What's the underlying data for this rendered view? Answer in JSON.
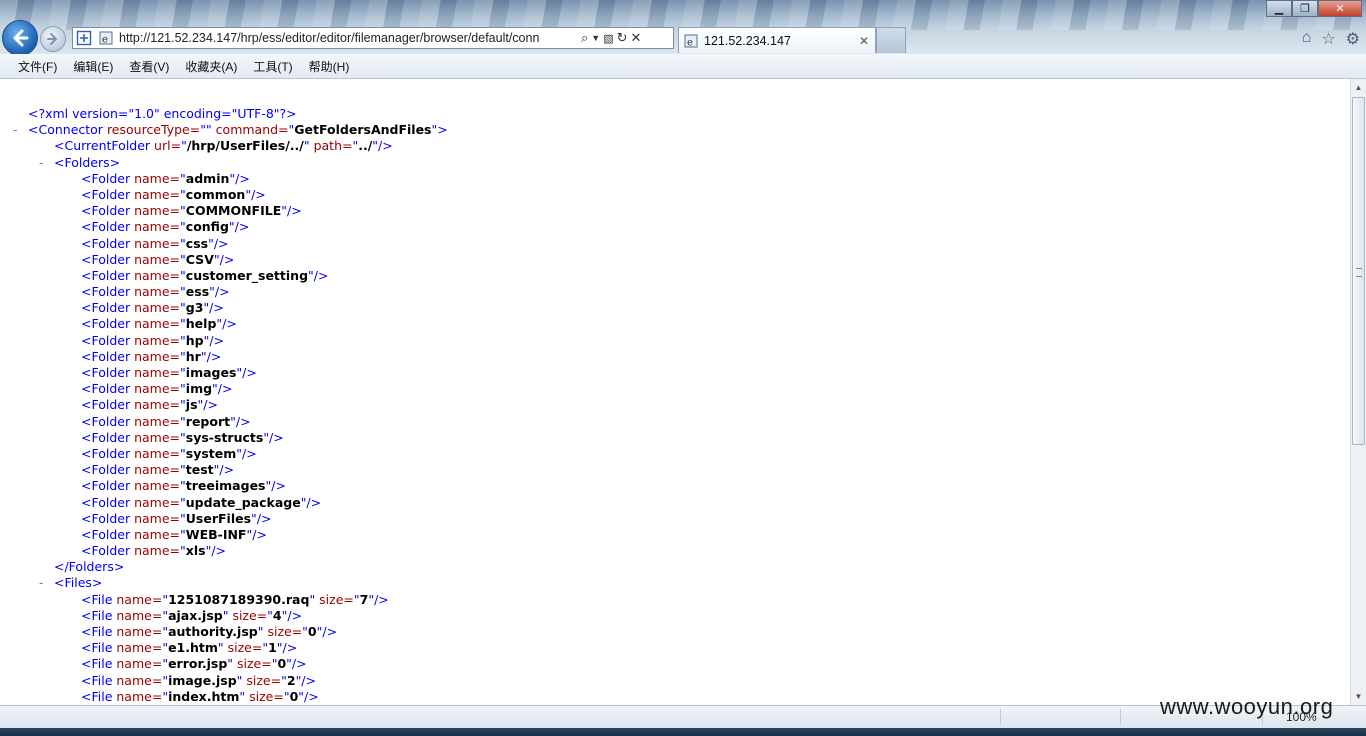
{
  "browser": {
    "url": "http://121.52.234.147/hrp/ess/editor/editor/filemanager/browser/default/conn",
    "tab_title": "121.52.234.147",
    "menu": [
      "文件(F)",
      "编辑(E)",
      "查看(V)",
      "收藏夹(A)",
      "工具(T)",
      "帮助(H)"
    ],
    "zoom": "100%",
    "watermark": "www.wooyun.org"
  },
  "xml": {
    "declaration": "<?xml version=\"1.0\" encoding=\"UTF-8\"?>",
    "connector": {
      "resourceType": "",
      "command": "GetFoldersAndFiles"
    },
    "current_folder": {
      "url": "/hrp/UserFiles/../",
      "path": "../"
    },
    "folders": [
      "admin",
      "common",
      "COMMONFILE",
      "config",
      "css",
      "CSV",
      "customer_setting",
      "ess",
      "g3",
      "help",
      "hp",
      "hr",
      "images",
      "img",
      "js",
      "report",
      "sys-structs",
      "system",
      "test",
      "treeimages",
      "update_package",
      "UserFiles",
      "WEB-INF",
      "xls"
    ],
    "files": [
      {
        "name": "1251087189390.raq",
        "size": "7"
      },
      {
        "name": "ajax.jsp",
        "size": "4"
      },
      {
        "name": "authority.jsp",
        "size": "0"
      },
      {
        "name": "e1.htm",
        "size": "1"
      },
      {
        "name": "error.jsp",
        "size": "0"
      },
      {
        "name": "image.jsp",
        "size": "2"
      },
      {
        "name": "index.htm",
        "size": "0"
      }
    ]
  }
}
